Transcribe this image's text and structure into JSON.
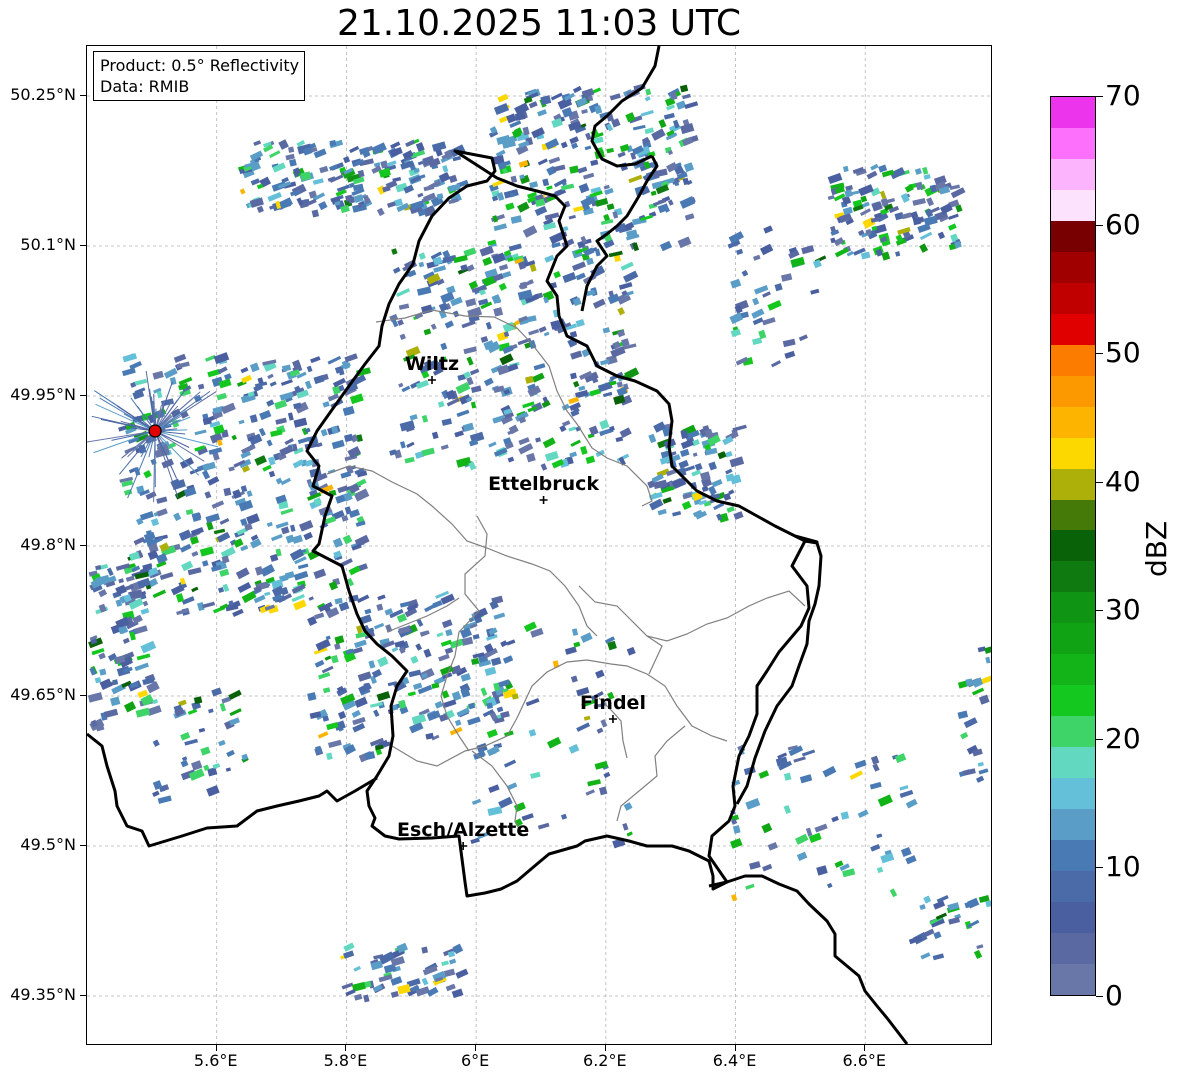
{
  "title": "21.10.2025 11:03 UTC",
  "info": {
    "product": "Product: 0.5° Reflectivity",
    "data": "Data: RMIB"
  },
  "lat_ticks": [
    {
      "value": 50.25,
      "label": "50.25°N"
    },
    {
      "value": 50.1,
      "label": "50.1°N"
    },
    {
      "value": 49.95,
      "label": "49.95°N"
    },
    {
      "value": 49.8,
      "label": "49.8°N"
    },
    {
      "value": 49.65,
      "label": "49.65°N"
    },
    {
      "value": 49.5,
      "label": "49.5°N"
    },
    {
      "value": 49.35,
      "label": "49.35°N"
    }
  ],
  "lon_ticks": [
    {
      "value": 5.6,
      "label": "5.6°E"
    },
    {
      "value": 5.8,
      "label": "5.8°E"
    },
    {
      "value": 6.0,
      "label": "6°E"
    },
    {
      "value": 6.2,
      "label": "6.2°E"
    },
    {
      "value": 6.4,
      "label": "6.4°E"
    },
    {
      "value": 6.6,
      "label": "6.6°E"
    }
  ],
  "extent": {
    "lon_min": 5.4,
    "lon_max": 6.797,
    "lat_min": 49.3,
    "lat_max": 50.3
  },
  "cities": [
    {
      "name": "Wiltz",
      "lon": 5.932,
      "lat": 49.966
    },
    {
      "name": "Ettelbruck",
      "lon": 6.104,
      "lat": 49.846
    },
    {
      "name": "Findel",
      "lon": 6.211,
      "lat": 49.627
    },
    {
      "name": "Esch/Alzette",
      "lon": 5.98,
      "lat": 49.5
    }
  ],
  "radar_site": {
    "lon": 5.505,
    "lat": 49.915,
    "color": "#e00000"
  },
  "colorbar": {
    "label": "dBZ",
    "ticks": [
      "0",
      "10",
      "20",
      "30",
      "40",
      "50",
      "60",
      "70"
    ],
    "range": [
      0,
      70
    ],
    "step": 2.5,
    "colors": [
      "#6876a8",
      "#5a69a2",
      "#4a5fa0",
      "#4a6aa8",
      "#4a7ab4",
      "#5a9ec8",
      "#64c0d8",
      "#62d8c0",
      "#3ed468",
      "#14c820",
      "#12b418",
      "#10a414",
      "#109414",
      "#0e7a10",
      "#0a6208",
      "#467a08",
      "#acb008",
      "#fcd800",
      "#fcb400",
      "#fc9800",
      "#fc7c00",
      "#e00000",
      "#c00000",
      "#a00000",
      "#780000",
      "#fce2fc",
      "#fcb4fc",
      "#fc70fc",
      "#ec34ec"
    ]
  },
  "colors": {
    "border_country": "#000000",
    "border_canton": "#808080",
    "grid": "#b4b4b4"
  }
}
